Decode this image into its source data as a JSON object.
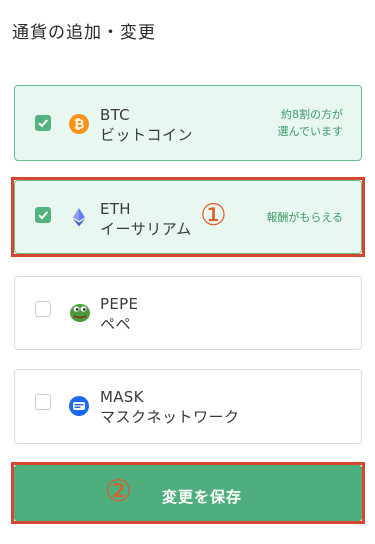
{
  "header": {
    "title": "通貨の追加・変更"
  },
  "currencies": [
    {
      "symbol": "BTC",
      "name": "ビットコイン",
      "checked": true,
      "note": [
        "約8割の方が",
        "選んでいます"
      ],
      "icon": "bitcoin-icon",
      "color": "#f7931a"
    },
    {
      "symbol": "ETH",
      "name": "イーサリアム",
      "checked": true,
      "note": [
        "報酬がもらえる"
      ],
      "icon": "ethereum-icon",
      "color": "#627eea"
    },
    {
      "symbol": "PEPE",
      "name": "ペペ",
      "checked": false,
      "note": [],
      "icon": "pepe-frog-icon",
      "color": "#4c9a3a"
    },
    {
      "symbol": "MASK",
      "name": "マスクネットワーク",
      "checked": false,
      "note": [],
      "icon": "mask-network-icon",
      "color": "#1c68f3"
    }
  ],
  "save_button": {
    "label": "変更を保存"
  },
  "annotations": {
    "one": "①",
    "two": "②"
  },
  "colors": {
    "accent_green": "#4eae7d",
    "selected_bg": "#e8f7ef",
    "annotation_red": "#d9462f"
  }
}
